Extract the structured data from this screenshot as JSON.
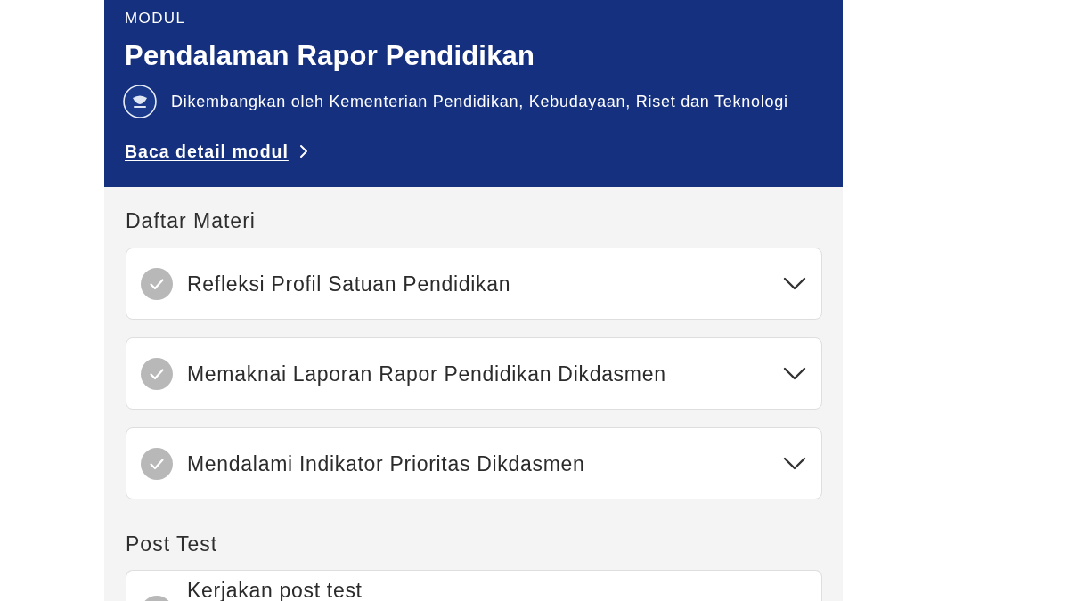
{
  "header": {
    "label": "MODUL",
    "title": "Pendalaman Rapor Pendidikan",
    "developer": "Dikembangkan oleh Kementerian Pendidikan, Kebudayaan, Riset dan Teknologi",
    "detail_link": "Baca detail modul"
  },
  "sections": [
    {
      "heading": "Daftar Materi",
      "items": [
        {
          "title": "Refleksi Profil Satuan Pendidikan",
          "completed": false,
          "expanded": false
        },
        {
          "title": "Memaknai Laporan Rapor Pendidikan Dikdasmen",
          "completed": false,
          "expanded": false
        },
        {
          "title": "Mendalami Indikator Prioritas Dikdasmen",
          "completed": false,
          "expanded": false
        }
      ]
    },
    {
      "heading": "Post Test",
      "items": [
        {
          "title": "Kerjakan post test",
          "completed": false
        }
      ]
    }
  ]
}
